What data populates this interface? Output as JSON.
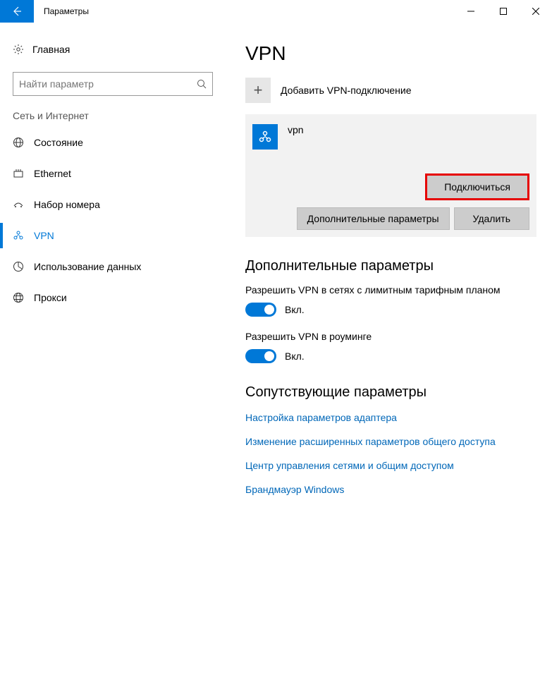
{
  "window": {
    "title": "Параметры"
  },
  "sidebar": {
    "home": "Главная",
    "search_placeholder": "Найти параметр",
    "group": "Сеть и Интернет",
    "items": [
      {
        "label": "Состояние"
      },
      {
        "label": "Ethernet"
      },
      {
        "label": "Набор номера"
      },
      {
        "label": "VPN"
      },
      {
        "label": "Использование данных"
      },
      {
        "label": "Прокси"
      }
    ]
  },
  "main": {
    "heading": "VPN",
    "add_label": "Добавить VPN-подключение",
    "connection": {
      "name": "vpn",
      "connect": "Подключиться",
      "advanced": "Дополнительные параметры",
      "delete": "Удалить"
    },
    "advanced_heading": "Дополнительные параметры",
    "settings": [
      {
        "desc": "Разрешить VPN в сетях с лимитным тарифным планом",
        "state": "Вкл."
      },
      {
        "desc": "Разрешить VPN в роуминге",
        "state": "Вкл."
      }
    ],
    "related_heading": "Сопутствующие параметры",
    "links": [
      "Настройка параметров адаптера",
      "Изменение расширенных параметров общего доступа",
      "Центр управления сетями и общим доступом",
      "Брандмауэр Windows"
    ]
  }
}
